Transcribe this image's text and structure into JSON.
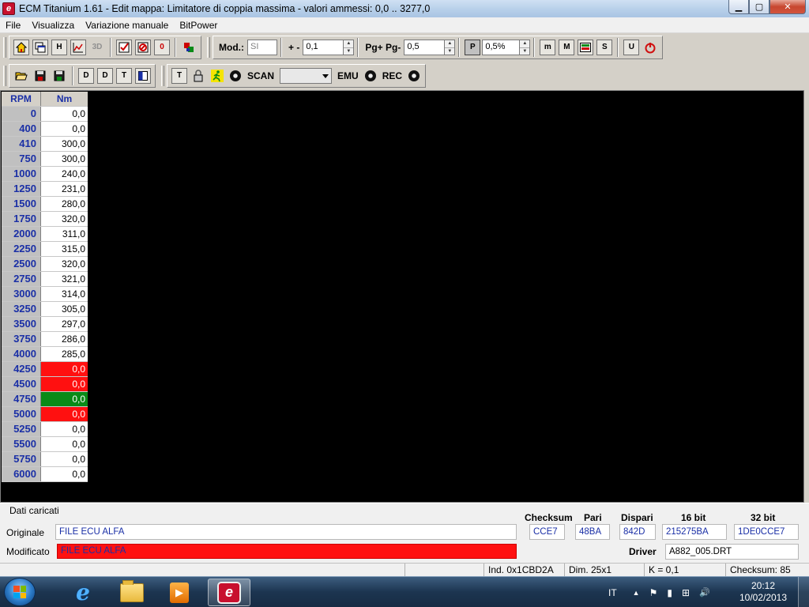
{
  "window": {
    "title": "ECM Titanium 1.61 - Edit mappa: Limitatore di coppia massima - valori ammessi: 0,0 .. 3277,0",
    "app_icon_glyph": "e",
    "minimize_glyph": "▁",
    "maximize_glyph": "▢",
    "close_glyph": "✕"
  },
  "menu": [
    "File",
    "Visualizza",
    "Variazione manuale",
    "BitPower"
  ],
  "toolbar1": {
    "icons_left": [
      "home-icon",
      "windows-icon",
      "h-table-icon",
      "chart-icon",
      "3d-icon",
      "check-icon",
      "disabled-icon",
      "zero-icon",
      "color-icon"
    ],
    "icon_glyphs": {
      "h": "H",
      "three_d": "3D",
      "zero": "0"
    },
    "mod_label": "Mod.:",
    "mod_value": "SI",
    "plusminus_label": "+ -",
    "plusminus_value": "0,1",
    "pg_label": "Pg+ Pg-",
    "pg_value": "0,5",
    "percent_icon_glyph": "P",
    "percent_value": "0,5%",
    "icons_right": [
      "m-icon",
      "M-icon",
      "map-icon",
      "S-icon",
      "U-icon",
      "power-icon"
    ],
    "icon_glyphs_right": {
      "m_small": "m",
      "m_big": "M",
      "s": "S",
      "u": "U"
    }
  },
  "toolbar2": {
    "icon_glyphs": {
      "d1": "D",
      "d2": "D",
      "t": "T",
      "t2": "T"
    },
    "scan_label": "SCAN",
    "scan_select_value": "",
    "emu_label": "EMU",
    "rec_label": "REC"
  },
  "table": {
    "headers": {
      "rpm": "RPM",
      "nm": "Nm"
    },
    "rows": [
      {
        "rpm": "0",
        "nm": "0,0",
        "state": "normal"
      },
      {
        "rpm": "400",
        "nm": "0,0",
        "state": "normal"
      },
      {
        "rpm": "410",
        "nm": "300,0",
        "state": "normal"
      },
      {
        "rpm": "750",
        "nm": "300,0",
        "state": "normal"
      },
      {
        "rpm": "1000",
        "nm": "240,0",
        "state": "normal"
      },
      {
        "rpm": "1250",
        "nm": "231,0",
        "state": "normal"
      },
      {
        "rpm": "1500",
        "nm": "280,0",
        "state": "normal"
      },
      {
        "rpm": "1750",
        "nm": "320,0",
        "state": "normal"
      },
      {
        "rpm": "2000",
        "nm": "311,0",
        "state": "normal"
      },
      {
        "rpm": "2250",
        "nm": "315,0",
        "state": "normal"
      },
      {
        "rpm": "2500",
        "nm": "320,0",
        "state": "normal"
      },
      {
        "rpm": "2750",
        "nm": "321,0",
        "state": "normal"
      },
      {
        "rpm": "3000",
        "nm": "314,0",
        "state": "normal"
      },
      {
        "rpm": "3250",
        "nm": "305,0",
        "state": "normal"
      },
      {
        "rpm": "3500",
        "nm": "297,0",
        "state": "normal"
      },
      {
        "rpm": "3750",
        "nm": "286,0",
        "state": "normal"
      },
      {
        "rpm": "4000",
        "nm": "285,0",
        "state": "normal"
      },
      {
        "rpm": "4250",
        "nm": "0,0",
        "state": "red"
      },
      {
        "rpm": "4500",
        "nm": "0,0",
        "state": "red"
      },
      {
        "rpm": "4750",
        "nm": "0,0",
        "state": "green"
      },
      {
        "rpm": "5000",
        "nm": "0,0",
        "state": "red"
      },
      {
        "rpm": "5250",
        "nm": "0,0",
        "state": "normal"
      },
      {
        "rpm": "5500",
        "nm": "0,0",
        "state": "normal"
      },
      {
        "rpm": "5750",
        "nm": "0,0",
        "state": "normal"
      },
      {
        "rpm": "6000",
        "nm": "0,0",
        "state": "normal"
      }
    ],
    "colors": {
      "red": "#ff1010",
      "green": "#0a8a17",
      "header_text": "#1a2fa6"
    }
  },
  "info": {
    "section_title": "Dati caricati",
    "originale_label": "Originale",
    "originale_value": "FILE ECU ALFA",
    "modificato_label": "Modificato",
    "modificato_value": "FILE ECU ALFA",
    "headers": {
      "checksum": "Checksum",
      "pari": "Pari",
      "dispari": "Dispari",
      "b16": "16 bit",
      "b32": "32 bit"
    },
    "values": {
      "checksum": "CCE7",
      "pari": "48BA",
      "dispari": "842D",
      "b16": "215275BA",
      "b32": "1DE0CCE7"
    },
    "driver_label": "Driver",
    "driver_value": "A882_005.DRT"
  },
  "status": {
    "ind": "Ind. 0x1CBD2A",
    "dim": "Dim. 25x1",
    "k": "K = 0,1",
    "checksum": "Checksum: 85"
  },
  "taskbar": {
    "ie_glyph": "e",
    "media_glyph": "▶",
    "ecm_glyph": "e",
    "language": "IT",
    "tray_glyphs": {
      "up": "▲",
      "flag": "⚑",
      "battery": "▮",
      "network": "⊞",
      "volume": "🔊"
    },
    "time": "20:12",
    "date": "10/02/2013"
  }
}
